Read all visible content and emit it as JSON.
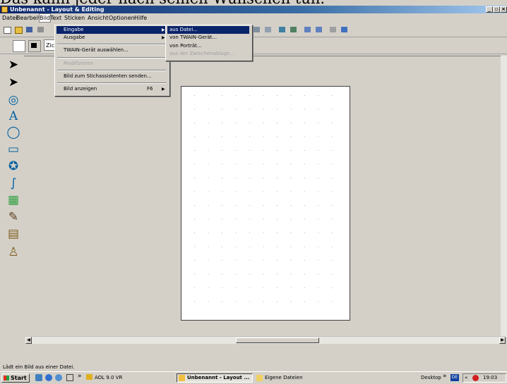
{
  "caption": "Das kann jeder nach seinen Wünschen tun.",
  "window": {
    "title": "Unbenannt - Layout & Editing",
    "controls": [
      "_",
      "▫",
      "×"
    ]
  },
  "menubar": [
    "Datei",
    "Bearbeiten",
    "Bild",
    "Text",
    "Sticken",
    "Ansicht",
    "Optionen",
    "Hilfe"
  ],
  "toolbar2": {
    "combo_value": "Zic"
  },
  "bild_menu": {
    "items": [
      {
        "label": "Eingabe",
        "arrow": "▶"
      },
      {
        "label": "Ausgabe",
        "arrow": "▶"
      },
      {
        "label": "TWAIN-Gerät auswählen..."
      },
      {
        "label": "Modifizieren"
      },
      {
        "label": "Bild zum Stichassistenten senden..."
      },
      {
        "label": "Bild anzeigen",
        "shortcut": "F6",
        "arrow": "▶"
      }
    ]
  },
  "eingabe_submenu": {
    "items": [
      "aus Datei...",
      "von TWAIN-Gerät...",
      "von Porträt...",
      "aus der Zwischenablage..."
    ]
  },
  "status": "Lädt ein Bild aus einer Datei.",
  "taskbar": {
    "start": "Start",
    "quick_more": "»",
    "tasks": [
      "AOL 9.0 VR",
      "Unbenannt - Layout ...",
      "Eigene Dateien"
    ],
    "desktop": "Desktop",
    "lang": "DE",
    "tray_more": "«",
    "clock": "19:03"
  },
  "colors": {
    "titlebar": "#0a246a",
    "highlight": "#0a246a",
    "face": "#d4d0c8"
  }
}
